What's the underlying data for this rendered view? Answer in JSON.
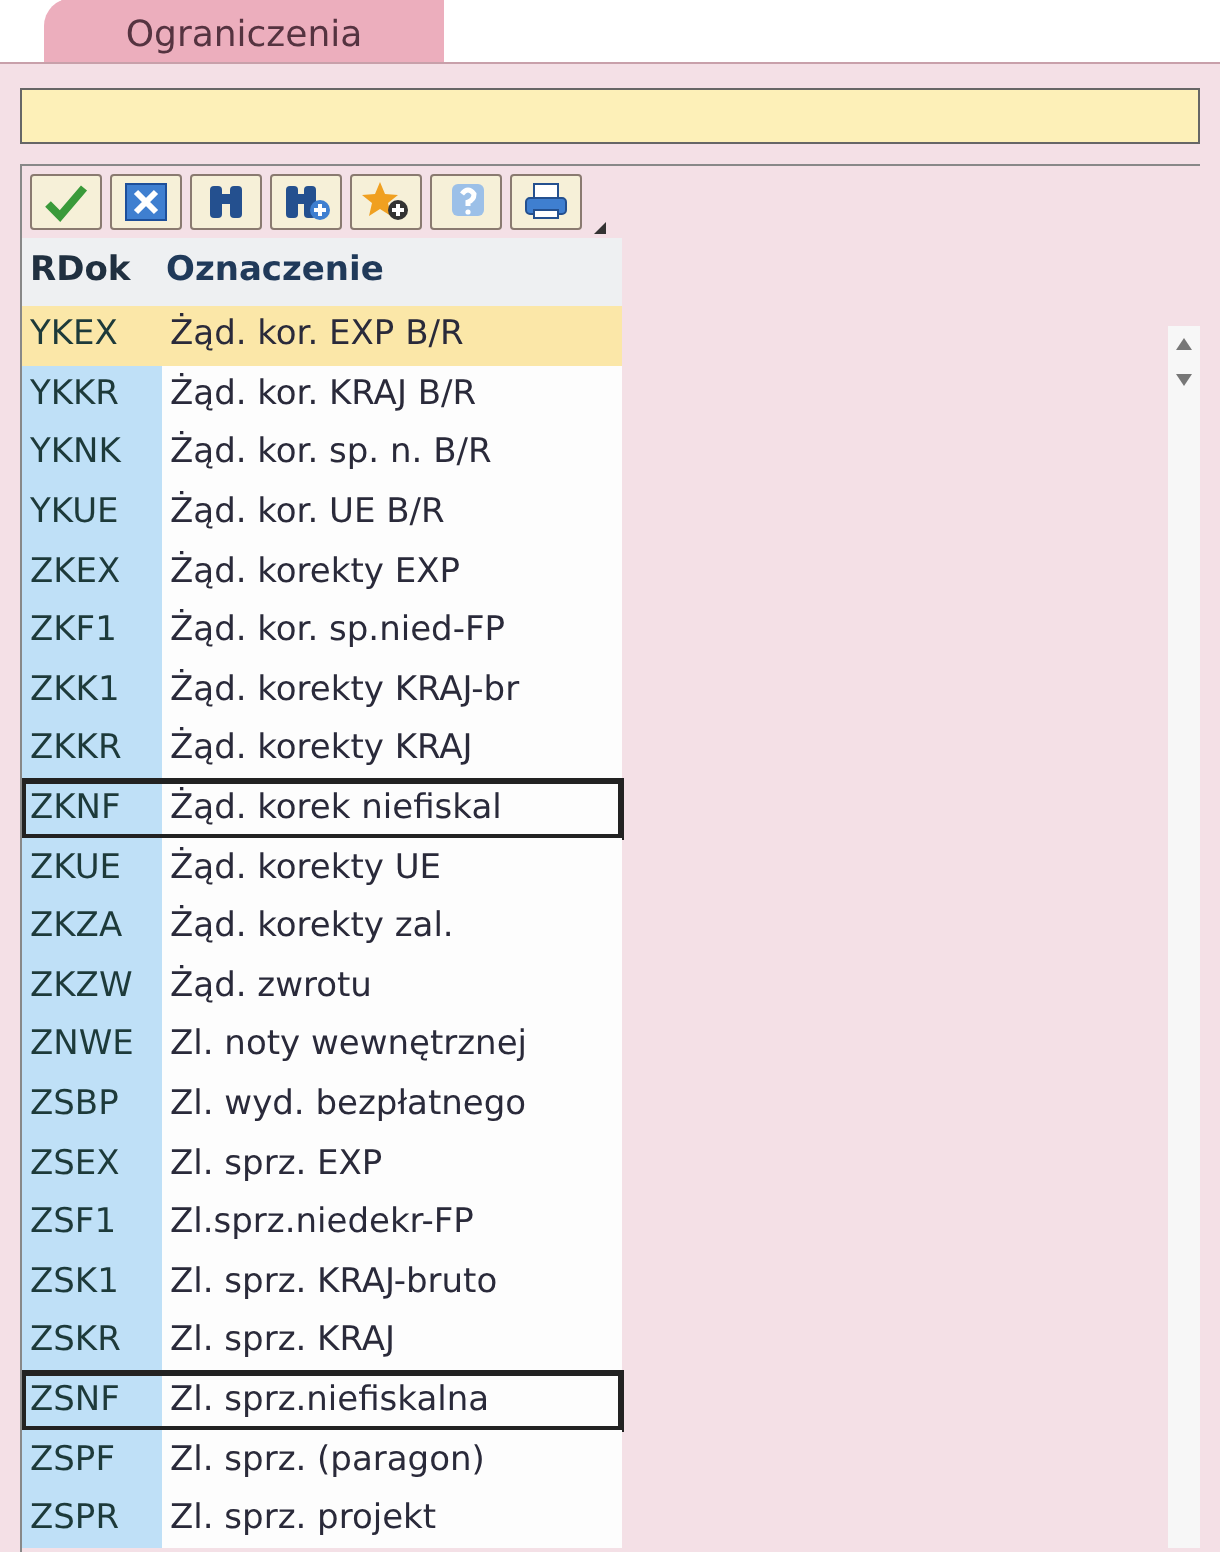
{
  "tab": {
    "label": "Ograniczenia",
    "selected": true
  },
  "toolbar": [
    {
      "kind": "check"
    },
    {
      "kind": "cancel"
    },
    {
      "kind": "find"
    },
    {
      "kind": "find-next"
    },
    {
      "kind": "favorite"
    },
    {
      "kind": "help"
    },
    {
      "kind": "print"
    }
  ],
  "table": {
    "columns": [
      "RDok",
      "Oznaczenie"
    ],
    "rows": [
      {
        "code": "YKEX",
        "name": "Żąd. kor. EXP B/R",
        "selected": true,
        "outlined": false
      },
      {
        "code": "YKKR",
        "name": "Żąd. kor. KRAJ B/R",
        "selected": false,
        "outlined": false
      },
      {
        "code": "YKNK",
        "name": "Żąd. kor. sp. n. B/R",
        "selected": false,
        "outlined": false
      },
      {
        "code": "YKUE",
        "name": "Żąd. kor. UE B/R",
        "selected": false,
        "outlined": false
      },
      {
        "code": "ZKEX",
        "name": "Żąd. korekty EXP",
        "selected": false,
        "outlined": false
      },
      {
        "code": "ZKF1",
        "name": "Żąd. kor. sp.nied-FP",
        "selected": false,
        "outlined": false
      },
      {
        "code": "ZKK1",
        "name": "Żąd. korekty KRAJ-br",
        "selected": false,
        "outlined": false
      },
      {
        "code": "ZKKR",
        "name": "Żąd. korekty KRAJ",
        "selected": false,
        "outlined": false
      },
      {
        "code": "ZKNF",
        "name": "Żąd. korek niefiskal",
        "selected": false,
        "outlined": true
      },
      {
        "code": "ZKUE",
        "name": "Żąd. korekty UE",
        "selected": false,
        "outlined": false
      },
      {
        "code": "ZKZA",
        "name": "Żąd. korekty zal.",
        "selected": false,
        "outlined": false
      },
      {
        "code": "ZKZW",
        "name": "Żąd. zwrotu",
        "selected": false,
        "outlined": false
      },
      {
        "code": "ZNWE",
        "name": "Zl. noty wewnętrznej",
        "selected": false,
        "outlined": false
      },
      {
        "code": "ZSBP",
        "name": "Zl. wyd. bezpłatnego",
        "selected": false,
        "outlined": false
      },
      {
        "code": "ZSEX",
        "name": "Zl. sprz. EXP",
        "selected": false,
        "outlined": false
      },
      {
        "code": "ZSF1",
        "name": "Zl.sprz.niedekr-FP",
        "selected": false,
        "outlined": false
      },
      {
        "code": "ZSK1",
        "name": "Zl. sprz. KRAJ-bruto",
        "selected": false,
        "outlined": false
      },
      {
        "code": "ZSKR",
        "name": "Zl. sprz. KRAJ",
        "selected": false,
        "outlined": false
      },
      {
        "code": "ZSNF",
        "name": "Zl. sprz.niefiskalna",
        "selected": false,
        "outlined": true
      },
      {
        "code": "ZSPF",
        "name": "Zl. sprz. (paragon)",
        "selected": false,
        "outlined": false
      },
      {
        "code": "ZSPR",
        "name": "Zl. sprz. projekt",
        "selected": false,
        "outlined": false
      }
    ]
  }
}
